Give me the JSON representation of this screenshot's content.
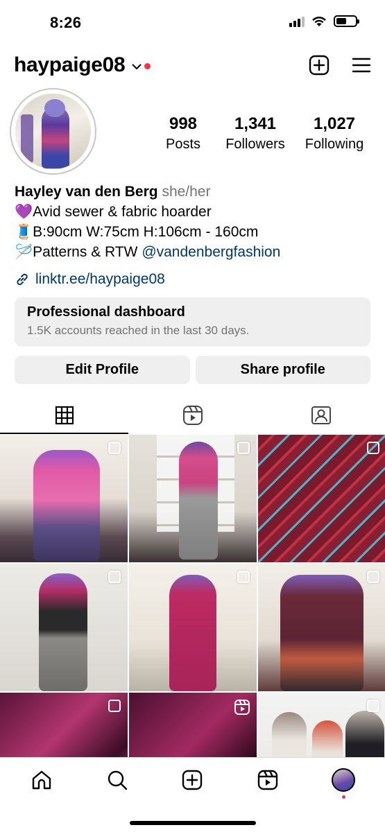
{
  "status_bar": {
    "time": "8:26",
    "battery_level": 0.55,
    "signal_bars": 3
  },
  "header": {
    "username": "haypaige08",
    "icons": [
      "chevron-down-icon",
      "notification-dot",
      "create-icon",
      "menu-icon"
    ]
  },
  "profile": {
    "stats": [
      {
        "value": "998",
        "label": "Posts"
      },
      {
        "value": "1,341",
        "label": "Followers"
      },
      {
        "value": "1,027",
        "label": "Following"
      }
    ],
    "name": "Hayley van den Berg",
    "pronouns": "she/her",
    "bio": [
      {
        "emoji": "💜",
        "text": "Avid sewer & fabric hoarder"
      },
      {
        "emoji": "🧵",
        "text": "B:90cm W:75cm H:106cm - 160cm"
      },
      {
        "emoji": "🪡",
        "text": "Patterns & RTW ",
        "mention": "@vandenbergfashion"
      }
    ],
    "link": "linktr.ee/haypaige08"
  },
  "dashboard": {
    "title": "Professional dashboard",
    "subtitle": "1.5K accounts reached in the last 30 days."
  },
  "buttons": {
    "edit": "Edit Profile",
    "share": "Share profile"
  },
  "tabs": [
    {
      "icon": "grid-icon",
      "active": true
    },
    {
      "icon": "reels-icon",
      "active": false
    },
    {
      "icon": "tagged-icon",
      "active": false
    }
  ],
  "bottom_nav": [
    "home-icon",
    "search-icon",
    "create-icon",
    "reels-icon",
    "profile-avatar"
  ],
  "colors": {
    "accent_red": "#ff3040",
    "link_blue": "#00376b",
    "secondary_text": "#737373",
    "button_bg": "#efefef"
  }
}
